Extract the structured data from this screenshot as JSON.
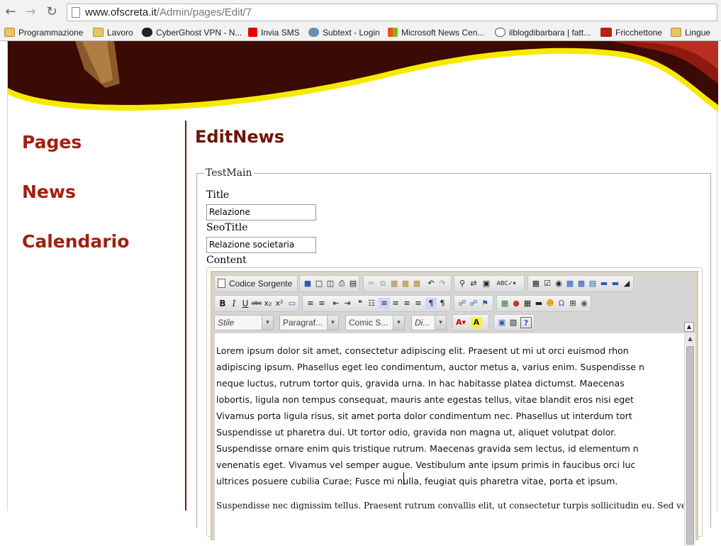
{
  "browser": {
    "url_host": "www.ofscreta.it",
    "url_path": "/Admin/pages/Edit/7",
    "bookmarks": [
      {
        "label": "Programmazione",
        "icon": "folder-icon"
      },
      {
        "label": "Lavoro",
        "icon": "folder-icon"
      },
      {
        "label": "CyberGhost VPN - N...",
        "icon": "ghost-icon"
      },
      {
        "label": "Invia SMS",
        "icon": "vodafone-icon"
      },
      {
        "label": "Subtext - Login",
        "icon": "globe-icon"
      },
      {
        "label": "Microsoft News Cen...",
        "icon": "windows-icon"
      },
      {
        "label": "ilblogdibarbara | fatt...",
        "icon": "wordpress-icon"
      },
      {
        "label": "Fricchettone",
        "icon": "site-icon"
      },
      {
        "label": "Lingue",
        "icon": "folder-icon"
      }
    ]
  },
  "sidebar": {
    "items": [
      {
        "label": "Pages"
      },
      {
        "label": "News"
      },
      {
        "label": "Calendario"
      }
    ]
  },
  "main": {
    "title": "EditNews",
    "fieldset_legend": "TestMain",
    "fields": {
      "title_label": "Title",
      "title_value": "Relazione",
      "seotitle_label": "SeoTitle",
      "seotitle_value": "Relazione societaria",
      "content_label": "Content"
    }
  },
  "editor": {
    "source_button": "Codice Sorgente",
    "combos": {
      "style": "Stile",
      "format": "Paragraf...",
      "font": "Comic S...",
      "size": "Di..."
    },
    "paragraph1": [
      "Lorem ipsum dolor sit amet, consectetur adipiscing elit. Praesent ut mi ut orci euismod rhon",
      "adipiscing ipsum. Phasellus eget leo condimentum, auctor metus a, varius enim. Suspendisse n",
      "neque luctus, rutrum tortor quis, gravida urna. In hac habitasse platea dictumst. Maecenas",
      "lobortis, ligula non tempus consequat, mauris ante egestas tellus, vitae blandit eros nisi eget",
      "Vivamus porta ligula risus, sit amet porta dolor condimentum nec. Phasellus ut interdum tort",
      "Suspendisse ut pharetra dui. Ut tortor odio, gravida non magna ut, aliquet volutpat dolor.",
      "Suspendisse ornare enim quis tristique rutrum. Maecenas gravida sem lectus, id elementum n",
      "venenatis eget. Vivamus vel semper augue. Vestibulum ante ipsum primis in faucibus orci luc",
      "ultrices posuere cubilia Curae; Fusce mi nulla, feugiat quis pharetra vitae, porta et ipsum."
    ],
    "paragraph2": "Suspendisse nec dignissim tellus. Praesent rutrum convallis elit, ut consectetur turpis sollicitudin eu. Sed vestibu"
  },
  "colors": {
    "nav_red": "#a2200e",
    "title_brown": "#6b1508",
    "banner_dark": "#3a0a04",
    "banner_yellow": "#f7ea00"
  }
}
